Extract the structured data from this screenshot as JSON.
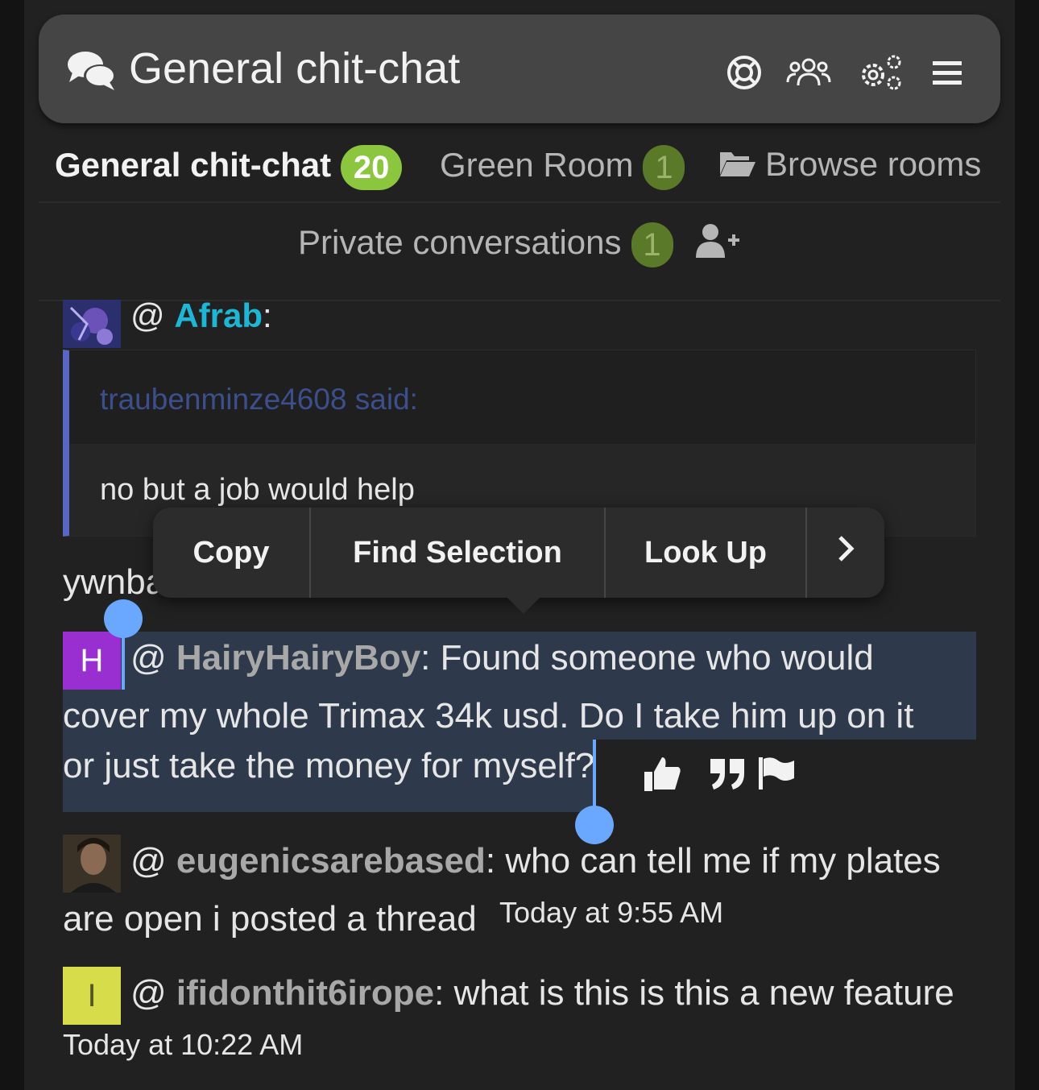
{
  "header": {
    "title": "General chit-chat",
    "icons": [
      "chat-bubbles-icon",
      "lifebuoy-icon",
      "users-icon",
      "settings-icon",
      "menu-icon"
    ]
  },
  "tabs": [
    {
      "label": "General chit-chat",
      "badge": "20",
      "active": true
    },
    {
      "label": "Green Room",
      "badge": "1",
      "active": false
    },
    {
      "label": "Browse rooms",
      "icon": "folder-open-icon"
    }
  ],
  "private": {
    "label": "Private conversations",
    "badge": "1",
    "icon": "add-user-icon"
  },
  "messages": [
    {
      "at": "@",
      "user": "Afrab",
      "colon": ":",
      "quote": {
        "attribution": "traubenminze4608 said:",
        "text": "no but a job would help"
      },
      "text": "ywnba"
    },
    {
      "avatar_letter": "H",
      "at": "@",
      "user": "HairyHairyBoy",
      "lines": [
        ": Found someone who would",
        "cover my whole Trimax 34k usd. Do I take him up on it",
        "or just take the money for myself?"
      ]
    },
    {
      "at": "@",
      "user": "eugenicsarebased",
      "lines": [
        ": who can tell me if my plates",
        "are open i posted a thread"
      ],
      "time": "Today at 9:55 AM"
    },
    {
      "avatar_letter": "I",
      "at": "@",
      "user": "ifidonthit6irope",
      "lines": [
        ": what is this is this a new feature"
      ],
      "time": "Today at 10:22 AM"
    }
  ],
  "context_menu": {
    "items": [
      "Copy",
      "Find Selection",
      "Look Up"
    ],
    "more": "›"
  },
  "colors": {
    "accent_green": "#8cc63f",
    "badge_green_dim": "#5a7a2a",
    "link_cyan": "#1fb6d6",
    "selection": "#2e3a4c",
    "handle": "#6aa7ff",
    "avatar_purple": "#9a2fd1",
    "avatar_yellow": "#d6dc4a"
  }
}
